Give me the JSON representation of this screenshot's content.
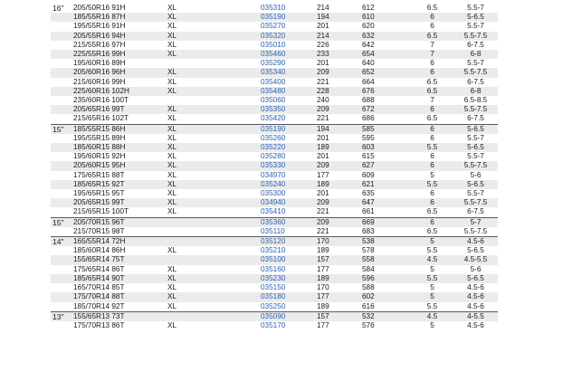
{
  "groups": [
    {
      "rim": "16\"",
      "rows": [
        {
          "size": "205/50R16 91H",
          "xl": "XL",
          "code": "035310",
          "v1": "214",
          "v2": "612",
          "v3": "6.5",
          "v4": "5.5-7"
        },
        {
          "size": "185/55R16 87H",
          "xl": "XL",
          "code": "035190",
          "v1": "194",
          "v2": "610",
          "v3": "6",
          "v4": "5-6.5"
        },
        {
          "size": "195/55R16 91H",
          "xl": "XL",
          "code": "035270",
          "v1": "201",
          "v2": "620",
          "v3": "6",
          "v4": "5.5-7"
        },
        {
          "size": "205/55R16 94H",
          "xl": "XL",
          "code": "035320",
          "v1": "214",
          "v2": "632",
          "v3": "6.5",
          "v4": "5.5-7.5"
        },
        {
          "size": "215/55R16 97H",
          "xl": "XL",
          "code": "035010",
          "v1": "226",
          "v2": "642",
          "v3": "7",
          "v4": "6-7.5"
        },
        {
          "size": "225/55R16 99H",
          "xl": "XL",
          "code": "035460",
          "v1": "233",
          "v2": "654",
          "v3": "7",
          "v4": "6-8"
        },
        {
          "size": "195/60R16 89H",
          "xl": "",
          "code": "035290",
          "v1": "201",
          "v2": "640",
          "v3": "6",
          "v4": "5.5-7"
        },
        {
          "size": "205/60R16 96H",
          "xl": "XL",
          "code": "035340",
          "v1": "209",
          "v2": "652",
          "v3": "6",
          "v4": "5.5-7.5"
        },
        {
          "size": "215/60R16 99H",
          "xl": "XL",
          "code": "035400",
          "v1": "221",
          "v2": "664",
          "v3": "6.5",
          "v4": "6-7.5"
        },
        {
          "size": "225/60R16 102H",
          "xl": "XL",
          "code": "035480",
          "v1": "228",
          "v2": "676",
          "v3": "6.5",
          "v4": "6-8"
        },
        {
          "size": "235/60R16 100T",
          "xl": "",
          "code": "035060",
          "v1": "240",
          "v2": "688",
          "v3": "7",
          "v4": "6.5-8.5"
        },
        {
          "size": "205/65R16 99T",
          "xl": "XL",
          "code": "035350",
          "v1": "209",
          "v2": "672",
          "v3": "6",
          "v4": "5.5-7.5"
        },
        {
          "size": "215/65R16 102T",
          "xl": "XL",
          "code": "035420",
          "v1": "221",
          "v2": "686",
          "v3": "6.5",
          "v4": "6-7.5"
        }
      ]
    },
    {
      "rim": "15\"",
      "rows": [
        {
          "size": "185/55R15 86H",
          "xl": "XL",
          "code": "035190",
          "v1": "194",
          "v2": "585",
          "v3": "6",
          "v4": "5-6.5"
        },
        {
          "size": "195/55R15 89H",
          "xl": "XL",
          "code": "035260",
          "v1": "201",
          "v2": "595",
          "v3": "6",
          "v4": "5.5-7"
        },
        {
          "size": "185/60R15 88H",
          "xl": "XL",
          "code": "035220",
          "v1": "189",
          "v2": "603",
          "v3": "5.5",
          "v4": "5-6.5"
        },
        {
          "size": "195/60R15 92H",
          "xl": "XL",
          "code": "035280",
          "v1": "201",
          "v2": "615",
          "v3": "6",
          "v4": "5.5-7"
        },
        {
          "size": "205/60R15 95H",
          "xl": "XL",
          "code": "035330",
          "v1": "209",
          "v2": "627",
          "v3": "6",
          "v4": "5.5-7.5"
        },
        {
          "size": "175/65R15 88T",
          "xl": "XL",
          "code": "034970",
          "v1": "177",
          "v2": "609",
          "v3": "5",
          "v4": "5-6"
        },
        {
          "size": "185/65R15 92T",
          "xl": "XL",
          "code": "035240",
          "v1": "189",
          "v2": "621",
          "v3": "5.5",
          "v4": "5-6.5"
        },
        {
          "size": "195/65R15 95T",
          "xl": "XL",
          "code": "035300",
          "v1": "201",
          "v2": "635",
          "v3": "6",
          "v4": "5.5-7"
        },
        {
          "size": "205/65R15 99T",
          "xl": "XL",
          "code": "034940",
          "v1": "209",
          "v2": "647",
          "v3": "6",
          "v4": "5.5-7.5"
        },
        {
          "size": "215/65R15 100T",
          "xl": "XL",
          "code": "035410",
          "v1": "221",
          "v2": "661",
          "v3": "6.5",
          "v4": "6-7.5"
        }
      ]
    },
    {
      "rim": "15\"",
      "rows": [
        {
          "size": "205/70R15 96T",
          "xl": "",
          "code": "035360",
          "v1": "209",
          "v2": "669",
          "v3": "6",
          "v4": "5-7"
        },
        {
          "size": "215/70R15 98T",
          "xl": "",
          "code": "035110",
          "v1": "221",
          "v2": "683",
          "v3": "6.5",
          "v4": "5.5-7.5"
        }
      ]
    },
    {
      "rim": "14\"",
      "rows": [
        {
          "size": "165/55R14 72H",
          "xl": "",
          "code": "035120",
          "v1": "170",
          "v2": "538",
          "v3": "5",
          "v4": "4.5-6"
        },
        {
          "size": "185/60R14 86H",
          "xl": "XL",
          "code": "035210",
          "v1": "189",
          "v2": "578",
          "v3": "5.5",
          "v4": "5-6.5"
        },
        {
          "size": "155/65R14 75T",
          "xl": "",
          "code": "035100",
          "v1": "157",
          "v2": "558",
          "v3": "4.5",
          "v4": "4.5-5.5"
        },
        {
          "size": "175/65R14 86T",
          "xl": "XL",
          "code": "035160",
          "v1": "177",
          "v2": "584",
          "v3": "5",
          "v4": "5-6"
        },
        {
          "size": "185/65R14 90T",
          "xl": "XL",
          "code": "035230",
          "v1": "189",
          "v2": "596",
          "v3": "5.5",
          "v4": "5-6.5"
        },
        {
          "size": "165/70R14 85T",
          "xl": "XL",
          "code": "035150",
          "v1": "170",
          "v2": "588",
          "v3": "5",
          "v4": "4.5-6"
        },
        {
          "size": "175/70R14 88T",
          "xl": "XL",
          "code": "035180",
          "v1": "177",
          "v2": "602",
          "v3": "5",
          "v4": "4.5-6"
        },
        {
          "size": "185/70R14 92T",
          "xl": "XL",
          "code": "035250",
          "v1": "189",
          "v2": "616",
          "v3": "5.5",
          "v4": "4.5-6"
        }
      ]
    },
    {
      "rim": "13\"",
      "rows": [
        {
          "size": "155/65R13 73T",
          "xl": "",
          "code": "035090",
          "v1": "157",
          "v2": "532",
          "v3": "4.5",
          "v4": "4-5.5"
        },
        {
          "size": "175/70R13 86T",
          "xl": "XL",
          "code": "035170",
          "v1": "177",
          "v2": "576",
          "v3": "5",
          "v4": "4.5-6"
        }
      ]
    }
  ]
}
